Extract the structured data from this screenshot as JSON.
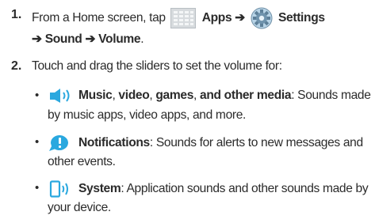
{
  "step1": {
    "number": "1.",
    "prefix": "From a Home screen, tap",
    "apps": "Apps",
    "arrow1": "➔",
    "settings": "Settings",
    "arrow2": "➔",
    "sound": "Sound",
    "arrow3": "➔",
    "volume": "Volume",
    "end": "."
  },
  "step2": {
    "number": "2.",
    "text": "Touch and drag the sliders to set the volume for:"
  },
  "bullets": [
    {
      "symbol": "•",
      "icon": "media-volume-icon",
      "t1": "Music",
      "t2": ", ",
      "t3": "video",
      "t4": ", ",
      "t5": "games",
      "t6": ", ",
      "t7": "and other media",
      "t8": ": Sounds made",
      "line2": "by music apps, video apps, and more."
    },
    {
      "symbol": "•",
      "icon": "notification-icon",
      "title": "Notifications",
      "rest": ": Sounds for alerts to new messages and",
      "line2": "other events."
    },
    {
      "symbol": "•",
      "icon": "system-sound-icon",
      "title": "System",
      "rest": ": Application sounds and other sounds made by",
      "line2": "your device."
    }
  ]
}
